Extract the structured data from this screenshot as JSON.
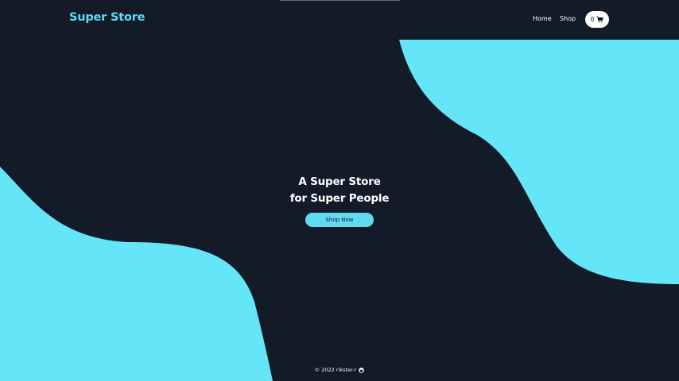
{
  "header": {
    "logo": "Super Store",
    "nav": [
      {
        "label": "Home"
      },
      {
        "label": "Shop"
      }
    ],
    "cart": {
      "count": "0",
      "icon": "cart-icon"
    }
  },
  "hero": {
    "line1": "A Super Store",
    "line2": "for Super People",
    "cta_label": "Shop Now"
  },
  "footer": {
    "text": "© 2022 rikster-r",
    "icon": "github-icon"
  },
  "colors": {
    "background": "#131a28",
    "accent": "#5fdaf2",
    "text": "#ffffff"
  }
}
